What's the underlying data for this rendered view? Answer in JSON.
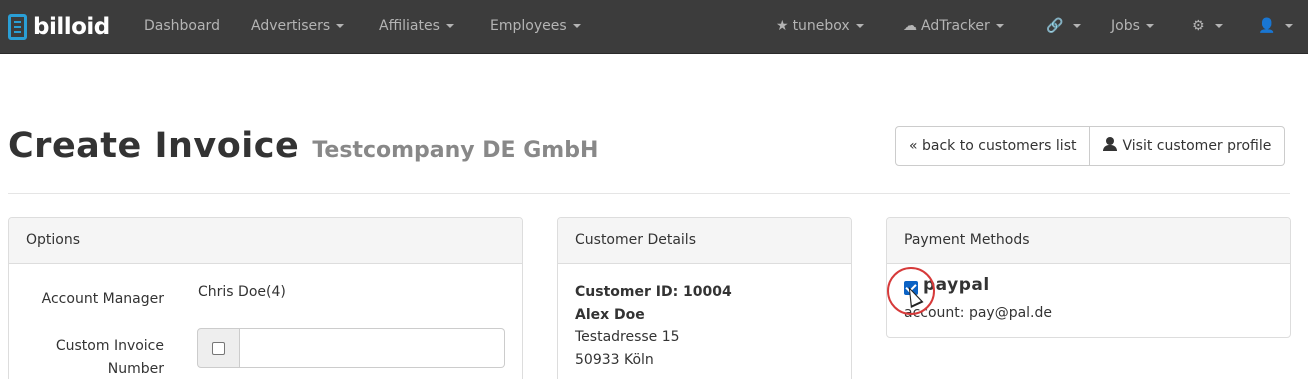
{
  "brand": {
    "name": "billoid",
    "icon": "invoice-icon",
    "accent": "#2a9fd6"
  },
  "navbar": {
    "left": [
      {
        "label": "Dashboard",
        "dropdown": false
      },
      {
        "label": "Advertisers",
        "dropdown": true
      },
      {
        "label": "Affiliates",
        "dropdown": true
      },
      {
        "label": "Employees",
        "dropdown": true
      }
    ],
    "right": [
      {
        "label": "tunebox",
        "icon": "star-icon",
        "dropdown": true
      },
      {
        "label": "AdTracker",
        "icon": "cloud-icon",
        "dropdown": true
      },
      {
        "label": "",
        "icon": "link-icon",
        "dropdown": true
      },
      {
        "label": "Jobs",
        "dropdown": true
      },
      {
        "label": "",
        "icon": "gear-icon",
        "dropdown": true
      },
      {
        "label": "",
        "icon": "user-icon",
        "dropdown": true
      }
    ]
  },
  "header": {
    "title": "Create Invoice",
    "subtitle": "Testcompany DE GmbH",
    "back_button": "« back to customers list",
    "profile_button": "Visit customer profile"
  },
  "options": {
    "heading": "Options",
    "account_manager_label": "Account Manager",
    "account_manager_value": "Chris Doe(4)",
    "custom_invoice_label_1": "Custom Invoice",
    "custom_invoice_label_2": "Number",
    "custom_invoice_checked": false,
    "custom_invoice_value": ""
  },
  "customer": {
    "heading": "Customer Details",
    "id_line": "Customer ID: 10004",
    "name": "Alex Doe",
    "street": "Testadresse 15",
    "city": "50933 Köln"
  },
  "payment": {
    "heading": "Payment Methods",
    "method": "paypal",
    "checked": true,
    "account": "account: pay@pal.de"
  }
}
